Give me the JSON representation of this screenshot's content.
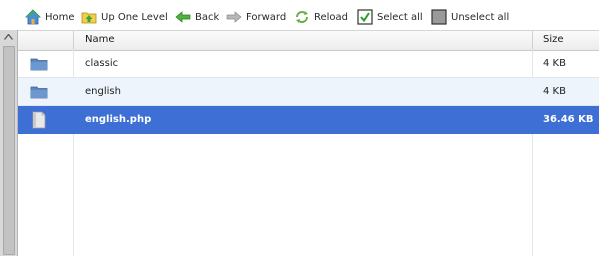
{
  "toolbar": {
    "home": {
      "label": "Home",
      "icon": "home-icon"
    },
    "up": {
      "label": "Up One Level",
      "icon": "folder-up-icon"
    },
    "back": {
      "label": "Back",
      "icon": "arrow-left-icon"
    },
    "forward": {
      "label": "Forward",
      "icon": "arrow-right-icon"
    },
    "reload": {
      "label": "Reload",
      "icon": "reload-icon"
    },
    "select_all": {
      "label": "Select all",
      "icon": "checkbox-checked-icon"
    },
    "unselect_all": {
      "label": "Unselect all",
      "icon": "checkbox-empty-icon"
    }
  },
  "table": {
    "columns": {
      "name": "Name",
      "size": "Size"
    },
    "rows": [
      {
        "name": "classic",
        "size": "4 KB",
        "type": "folder",
        "selected": false
      },
      {
        "name": "english",
        "size": "4 KB",
        "type": "folder",
        "selected": false
      },
      {
        "name": "english.php",
        "size": "36.46 KB",
        "type": "file",
        "selected": true
      }
    ]
  },
  "colors": {
    "selection": "#3d6fd5",
    "alt_row": "#eef4fc",
    "folder": "#5b86c0"
  }
}
